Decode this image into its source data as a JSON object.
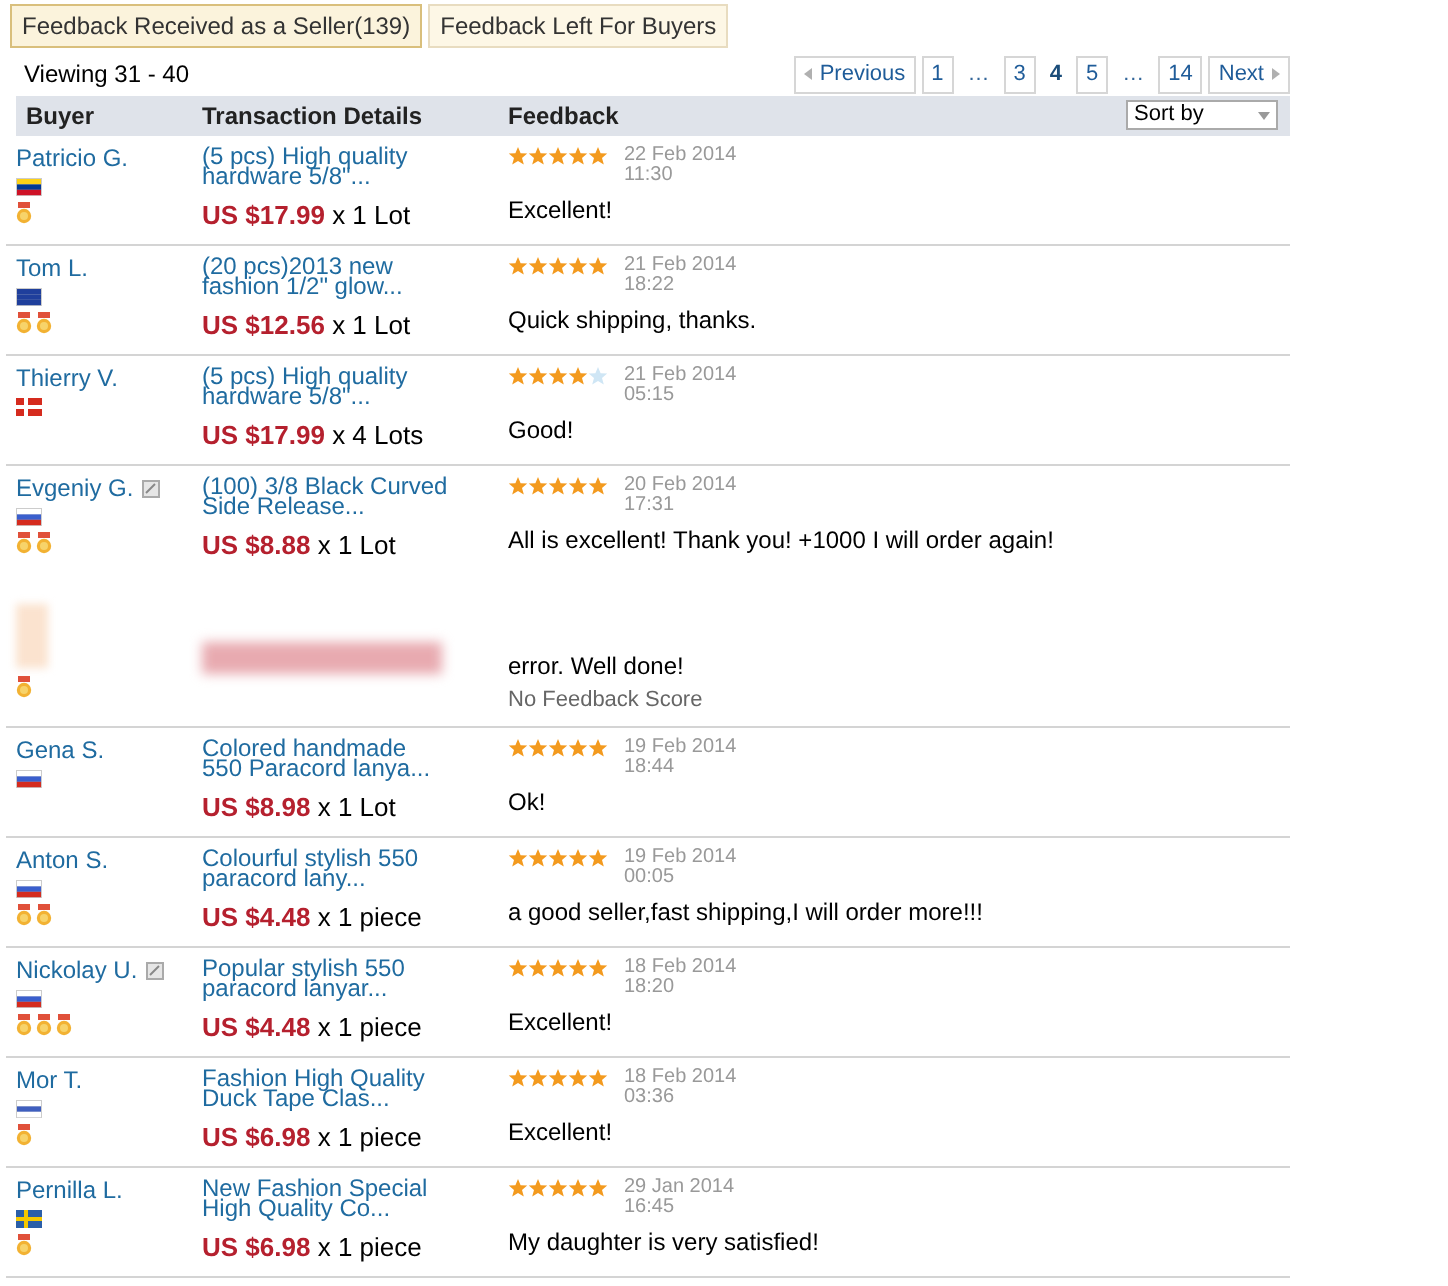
{
  "tabs": [
    {
      "label": "Feedback Received as a Seller(139)",
      "selected": true
    },
    {
      "label": "Feedback Left For Buyers",
      "selected": false
    }
  ],
  "viewing": "Viewing 31 - 40",
  "pagination": [
    {
      "kind": "prev",
      "label": "Previous"
    },
    {
      "kind": "page",
      "label": "1",
      "selected": false
    },
    {
      "kind": "ellipsis",
      "label": "…"
    },
    {
      "kind": "page",
      "label": "3",
      "selected": false
    },
    {
      "kind": "page",
      "label": "4",
      "selected": true
    },
    {
      "kind": "page",
      "label": "5",
      "selected": false
    },
    {
      "kind": "ellipsis",
      "label": "…"
    },
    {
      "kind": "page",
      "label": "14",
      "selected": false
    },
    {
      "kind": "next",
      "label": "Next"
    }
  ],
  "table": {
    "columns": [
      "Buyer",
      "Transaction Details",
      "Feedback"
    ],
    "sort": "Sort by",
    "rows": [
      {
        "kind": "review",
        "buyer": "Patricio G.",
        "has_message": false,
        "flag": {
          "kind": "colombia"
        },
        "medals": [
          {
            "kind": "medal"
          }
        ],
        "product": "(5 pcs) High quality hardware 5/8\"...",
        "price": "US $17.99",
        "quantity": "x 1 Lot",
        "stars": 5,
        "date": "22 Feb 2014",
        "time": "11:30",
        "feedback": "Excellent!"
      },
      {
        "kind": "review",
        "buyer": "Tom L.",
        "has_message": false,
        "flag": {
          "kind": "australia"
        },
        "medals": [
          {
            "kind": "medal"
          },
          {
            "kind": "medal"
          }
        ],
        "product": "(20 pcs)2013 new fashion 1/2\" glow...",
        "price": "US $12.56",
        "quantity": "x 1 Lot",
        "stars": 5,
        "date": "21 Feb 2014",
        "time": "18:22",
        "feedback": "Quick shipping, thanks."
      },
      {
        "kind": "review",
        "buyer": "Thierry V.",
        "has_message": false,
        "flag": {
          "kind": "switzerland"
        },
        "medals": [],
        "product": "(5 pcs) High quality hardware 5/8\"...",
        "price": "US $17.99",
        "quantity": "x 4 Lots",
        "stars": 4,
        "date": "21 Feb 2014",
        "time": "05:15",
        "feedback": "Good!"
      },
      {
        "kind": "review",
        "buyer": "Evgeniy G.",
        "has_message": true,
        "flag": {
          "kind": "russia"
        },
        "medals": [
          {
            "kind": "medal"
          },
          {
            "kind": "medal"
          }
        ],
        "product": "(100) 3/8 Black Curved Side Release...",
        "price": "US $8.88",
        "quantity": "x 1 Lot",
        "stars": 5,
        "date": "20 Feb 2014",
        "time": "17:31",
        "feedback": "All is excellent! Thank you! +1000 I will order again!"
      },
      {
        "kind": "obscured",
        "medals": [
          {
            "kind": "medal"
          }
        ],
        "feedback": "error. Well done!",
        "note": "No Feedback Score"
      },
      {
        "kind": "review",
        "buyer": "Gena S.",
        "has_message": false,
        "flag": {
          "kind": "russia"
        },
        "medals": [],
        "product": "Colored handmade 550 Paracord lanya...",
        "price": "US $8.98",
        "quantity": "x 1 Lot",
        "stars": 5,
        "date": "19 Feb 2014",
        "time": "18:44",
        "feedback": "Ok!"
      },
      {
        "kind": "review",
        "buyer": "Anton S.",
        "has_message": false,
        "flag": {
          "kind": "russia"
        },
        "medals": [
          {
            "kind": "medal"
          },
          {
            "kind": "medal"
          }
        ],
        "product": "Colourful stylish 550 paracord lany...",
        "price": "US $4.48",
        "quantity": "x 1 piece",
        "stars": 5,
        "date": "19 Feb 2014",
        "time": "00:05",
        "feedback": "a good seller,fast shipping,I will order more!!!"
      },
      {
        "kind": "review",
        "buyer": "Nickolay U.",
        "has_message": true,
        "flag": {
          "kind": "russia"
        },
        "medals": [
          {
            "kind": "medal"
          },
          {
            "kind": "medal"
          },
          {
            "kind": "medal"
          }
        ],
        "product": "Popular stylish 550 paracord lanyar...",
        "price": "US $4.48",
        "quantity": "x 1 piece",
        "stars": 5,
        "date": "18 Feb 2014",
        "time": "18:20",
        "feedback": "Excellent!"
      },
      {
        "kind": "review",
        "buyer": "Mor T.",
        "has_message": false,
        "flag": {
          "kind": "israel"
        },
        "medals": [
          {
            "kind": "medal"
          }
        ],
        "product": "Fashion High Quality Duck Tape Clas...",
        "price": "US $6.98",
        "quantity": "x 1 piece",
        "stars": 5,
        "date": "18 Feb 2014",
        "time": "03:36",
        "feedback": "Excellent!"
      },
      {
        "kind": "review",
        "buyer": "Pernilla L.",
        "has_message": false,
        "flag": {
          "kind": "sweden"
        },
        "medals": [
          {
            "kind": "medal"
          }
        ],
        "product": "New Fashion Special High Quality Co...",
        "price": "US $6.98",
        "quantity": "x 1 piece",
        "stars": 5,
        "date": "29 Jan 2014",
        "time": "16:45",
        "feedback": "My daughter is very satisfied!"
      }
    ]
  }
}
